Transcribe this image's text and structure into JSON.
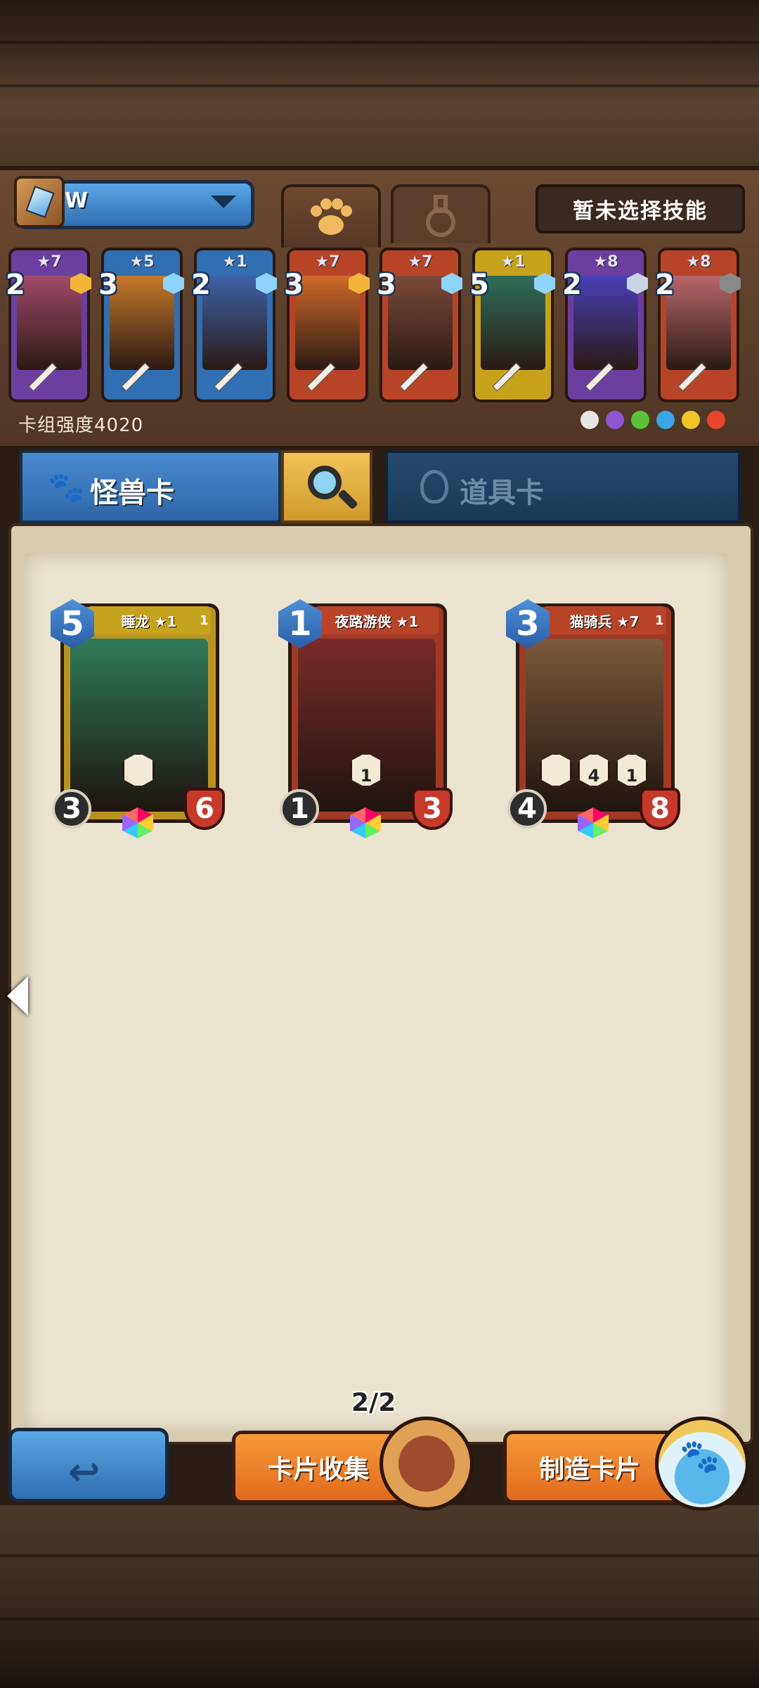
{
  "header": {
    "deck_name": "W",
    "tabs": [
      {
        "icon": "paw-icon",
        "active": true
      },
      {
        "icon": "potion-icon",
        "active": false
      }
    ],
    "skill_button_label": "暂未选择技能"
  },
  "deck": {
    "cards": [
      {
        "cost": "2",
        "stars": "★7",
        "color": "#6b3fa0",
        "art": "#a14a6a",
        "gem": "#f4b53b"
      },
      {
        "cost": "3",
        "stars": "★5",
        "color": "#2f6fb2",
        "art": "#c6792a",
        "gem": "#8fd3ff"
      },
      {
        "cost": "2",
        "stars": "★1",
        "color": "#2f6fb2",
        "art": "#3f62a8",
        "gem": "#8fd3ff"
      },
      {
        "cost": "3",
        "stars": "★7",
        "color": "#b84428",
        "art": "#d06a2a",
        "gem": "#f4b53b"
      },
      {
        "cost": "3",
        "stars": "★7",
        "color": "#b84428",
        "art": "#7b4a3a",
        "gem": "#8fd3ff"
      },
      {
        "cost": "5",
        "stars": "★1",
        "color": "#c9a21c",
        "art": "#2f6e5a",
        "gem": "#8fd3ff"
      },
      {
        "cost": "2",
        "stars": "★8",
        "color": "#6b3fa0",
        "art": "#4a3fb8",
        "gem": "#c9d4e6"
      },
      {
        "cost": "2",
        "stars": "★8",
        "color": "#b84428",
        "art": "#b8666a",
        "gem": "#8a8a8a"
      }
    ],
    "power_label": "卡组强度4020",
    "element_icons": [
      {
        "name": "neutral-icon",
        "color": "#e6e6e6"
      },
      {
        "name": "shadow-icon",
        "color": "#8d56d6"
      },
      {
        "name": "nature-icon",
        "color": "#58c23a"
      },
      {
        "name": "water-icon",
        "color": "#3aa4e6"
      },
      {
        "name": "lightning-icon",
        "color": "#f1c52a"
      },
      {
        "name": "fire-icon",
        "color": "#e8452a"
      }
    ]
  },
  "categories": {
    "monster_label": "怪兽卡",
    "items_label": "道具卡"
  },
  "collection": {
    "cards": [
      {
        "name": "睡龙 ★1",
        "cost": "5",
        "attack": "3",
        "health": "6",
        "tier": "1",
        "banner_color": "#c7a21e",
        "frame_color": "#b99322",
        "art": "#2f7c5a",
        "skills": [
          ""
        ]
      },
      {
        "name": "夜路游侠 ★1",
        "cost": "1",
        "attack": "1",
        "health": "3",
        "tier": "",
        "banner_color": "#b84428",
        "frame_color": "#a03a24",
        "art": "#7a2a28",
        "skills": [
          "1"
        ]
      },
      {
        "name": "猫骑兵 ★7",
        "cost": "3",
        "attack": "4",
        "health": "8",
        "tier": "1",
        "banner_color": "#b84428",
        "frame_color": "#a03a24",
        "art": "#7a5a3c",
        "skills": [
          "",
          "4",
          "1"
        ]
      }
    ],
    "pager": "2/2"
  },
  "footer": {
    "collect_label": "卡片收集",
    "craft_label": "制造卡片"
  }
}
